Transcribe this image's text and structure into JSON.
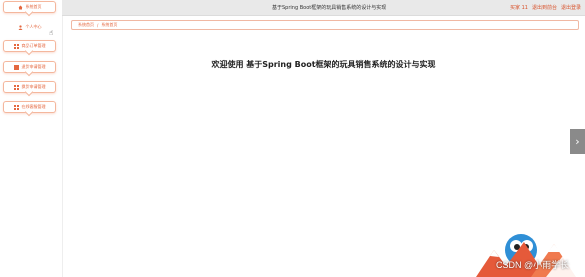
{
  "header": {
    "title": "基于Spring Boot框架的玩具销售系统的设计与实现",
    "links": [
      "买家 11",
      "退出到前台",
      "退出登录"
    ]
  },
  "sidebar": {
    "items": [
      {
        "label": "系统首页",
        "icon": "home-icon"
      },
      {
        "label": "个人中心",
        "icon": "user-icon"
      },
      {
        "label": "商品订单管理",
        "icon": "grid-icon"
      },
      {
        "label": "退货申请管理",
        "icon": "grid-icon"
      },
      {
        "label": "换货申请管理",
        "icon": "grid-icon"
      },
      {
        "label": "在线客服管理",
        "icon": "grid-icon"
      }
    ]
  },
  "breadcrumb": {
    "home": "系统首页",
    "separator": "/",
    "current": "系统首页"
  },
  "main": {
    "welcome": "欢迎使用 基于Spring Boot框架的玩具销售系统的设计与实现"
  },
  "watermark": {
    "text": "CSDN @小雨学长"
  },
  "colors": {
    "accent": "#e4673f",
    "topbar": "#e9e9e9",
    "border": "#f4b79d"
  }
}
